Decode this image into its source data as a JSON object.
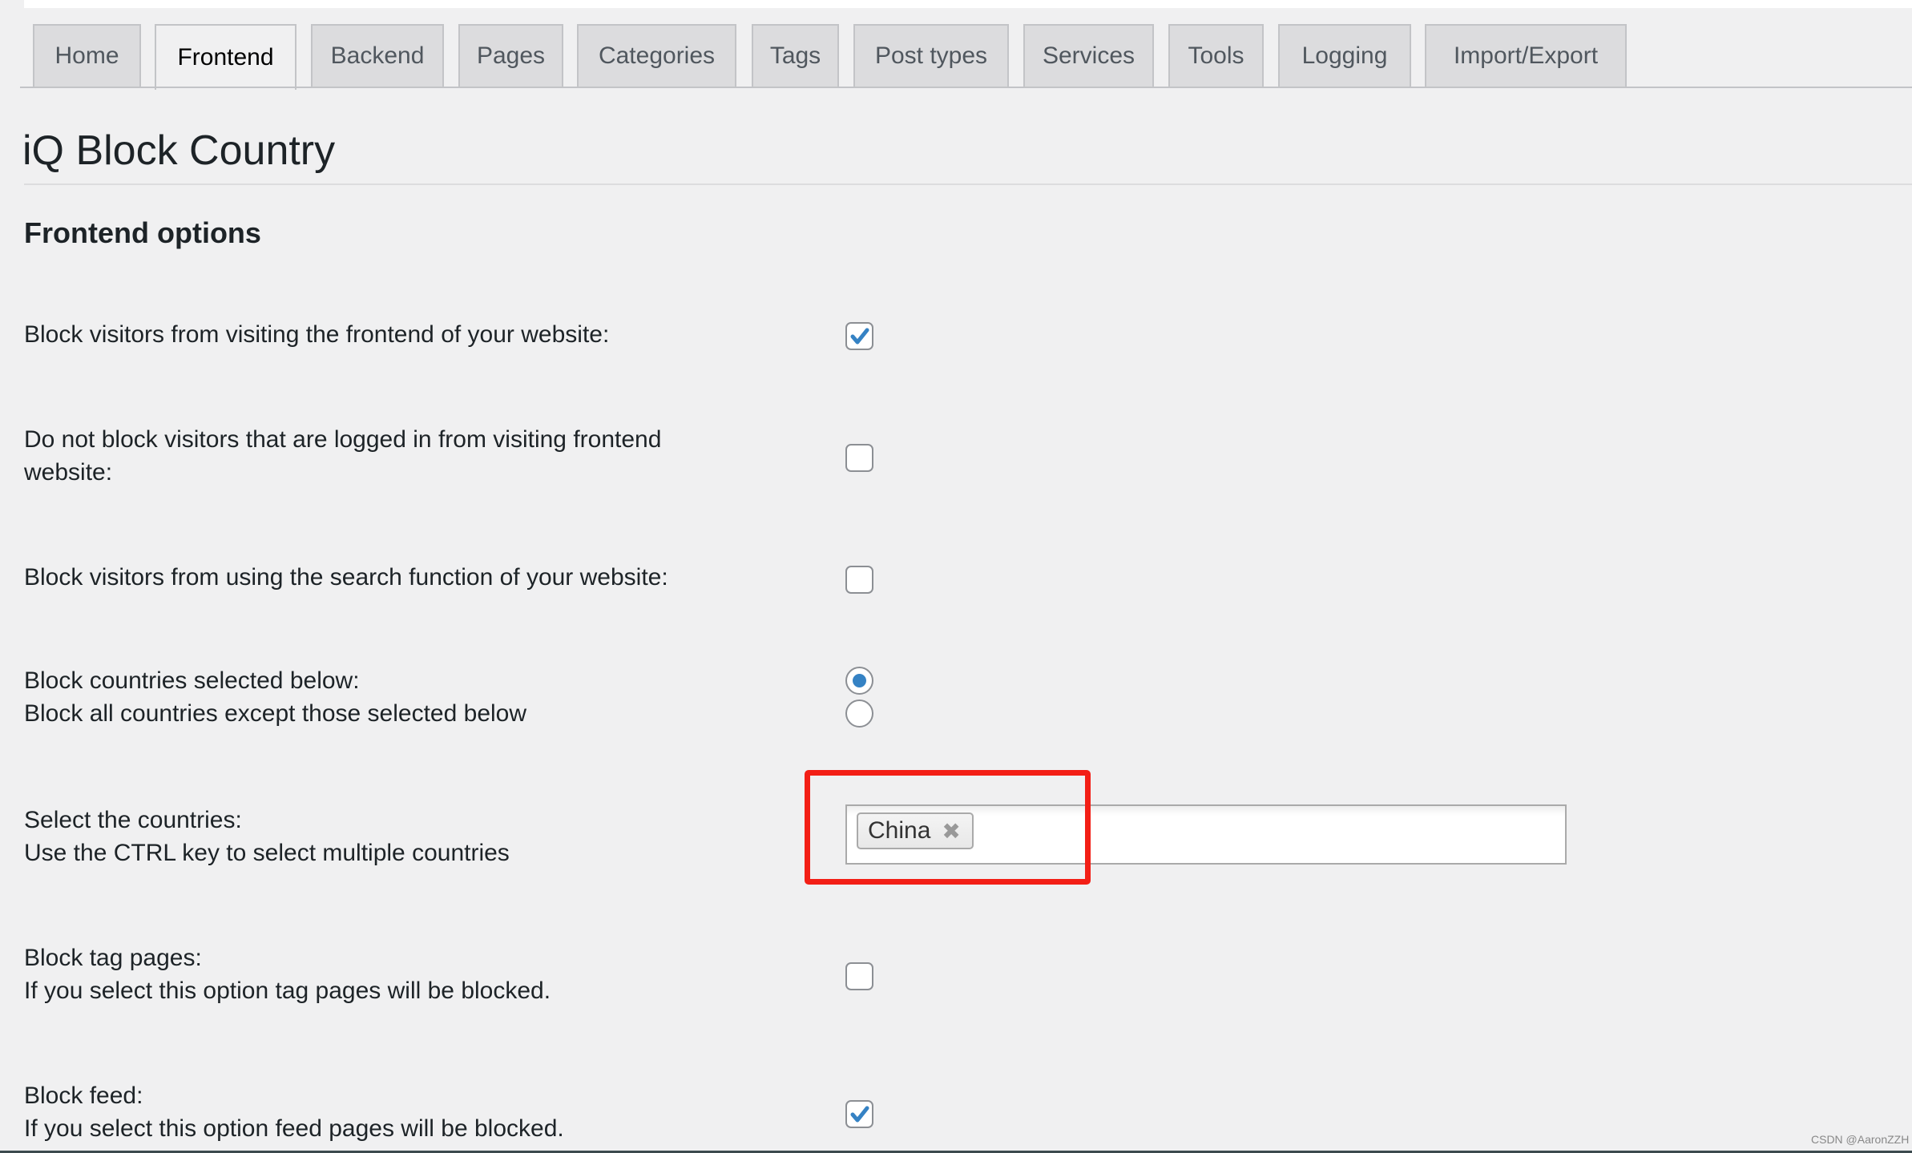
{
  "tabs": [
    {
      "label": "Home",
      "active": false
    },
    {
      "label": "Frontend",
      "active": true
    },
    {
      "label": "Backend",
      "active": false
    },
    {
      "label": "Pages",
      "active": false
    },
    {
      "label": "Categories",
      "active": false
    },
    {
      "label": "Tags",
      "active": false
    },
    {
      "label": "Post types",
      "active": false
    },
    {
      "label": "Services",
      "active": false
    },
    {
      "label": "Tools",
      "active": false
    },
    {
      "label": "Logging",
      "active": false
    },
    {
      "label": "Import/Export",
      "active": false
    }
  ],
  "page_title": "iQ Block Country",
  "section_title": "Frontend options",
  "options": {
    "block_frontend": {
      "label": "Block visitors from visiting the frontend of your website:",
      "checked": true
    },
    "allow_logged_in": {
      "label_line1": "Do not block visitors that are logged in from visiting frontend",
      "label_line2": "website:",
      "checked": false
    },
    "block_search": {
      "label": "Block visitors from using the search function of your website:",
      "checked": false
    },
    "block_mode": {
      "option1": "Block countries selected below:",
      "option2": "Block all countries except those selected below",
      "selected": "option1"
    },
    "countries": {
      "label_line1": "Select the countries:",
      "label_line2": "Use the CTRL key to select multiple countries",
      "selected": [
        "China"
      ],
      "remove_glyph": "✖"
    },
    "block_tag": {
      "label_line1": "Block tag pages:",
      "label_line2": "If you select this option tag pages will be blocked.",
      "checked": false
    },
    "block_feed": {
      "label_line1": "Block feed:",
      "label_line2": "If you select this option feed pages will be blocked.",
      "checked": true
    }
  },
  "colors": {
    "accent": "#3582c4",
    "highlight": "#f31f16"
  },
  "watermark": "CSDN @AaronZZH"
}
